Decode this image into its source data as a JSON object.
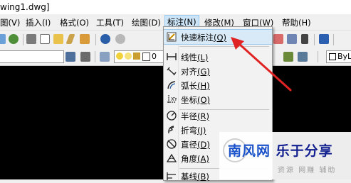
{
  "window": {
    "title": "wing1.dwg]"
  },
  "menubar": {
    "items": [
      {
        "label": "图(V)"
      },
      {
        "label": "插入(I)"
      },
      {
        "label": "格式(O)"
      },
      {
        "label": "工具(T)"
      },
      {
        "label": "绘图(D)"
      },
      {
        "label": "标注(N)"
      },
      {
        "label": "修改(M)"
      },
      {
        "label": "窗口(W)"
      },
      {
        "label": "帮助(H)"
      }
    ]
  },
  "layer_toolbar": {
    "layer_value": "0",
    "linetype_value": "ByL"
  },
  "dimension_menu": {
    "items": [
      {
        "label": "快速标注",
        "key": "(Q)",
        "icon": "quick-dimension-icon",
        "highlighted": true
      },
      {
        "label": "线性",
        "key": "(L)",
        "icon": "linear-dimension-icon"
      },
      {
        "label": "对齐",
        "key": "(G)",
        "icon": "aligned-dimension-icon"
      },
      {
        "label": "弧长",
        "key": "(H)",
        "icon": "arc-length-icon"
      },
      {
        "label": "坐标",
        "key": "(O)",
        "icon": "ordinate-icon"
      },
      {
        "label": "半径",
        "key": "(R)",
        "icon": "radius-icon"
      },
      {
        "label": "折弯",
        "key": "(J)",
        "icon": "jogged-icon"
      },
      {
        "label": "直径",
        "key": "(D)",
        "icon": "diameter-icon"
      },
      {
        "label": "角度",
        "key": "(A)",
        "icon": "angular-icon"
      },
      {
        "label": "基线",
        "key": "(B)",
        "icon": "baseline-icon"
      }
    ]
  },
  "watermark": {
    "part1": "南风网",
    "part2": "乐于分享",
    "subtitle": "资源 网赚 辅助"
  },
  "colors": {
    "arrow": "#e02424",
    "menu_highlight": "#d8eaf8",
    "canvas": "#000000"
  }
}
